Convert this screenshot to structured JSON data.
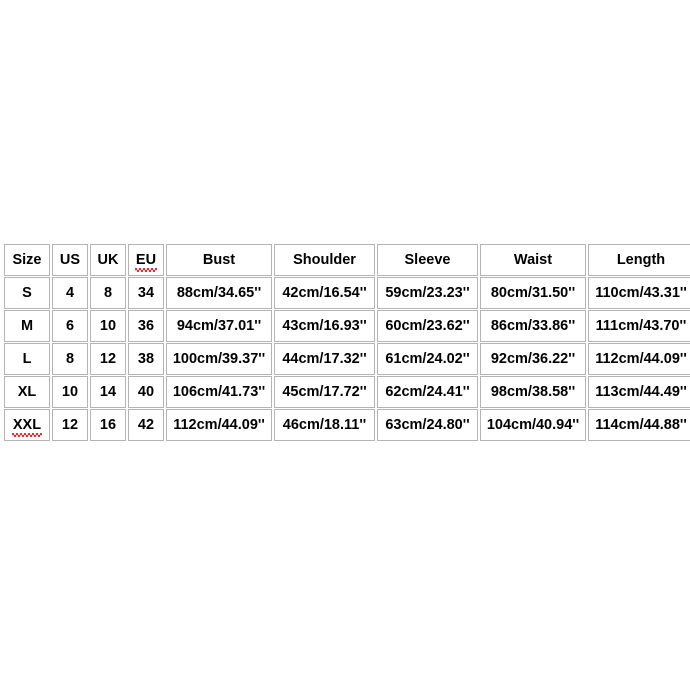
{
  "chart_data": {
    "type": "table",
    "title": "",
    "columns": [
      "Size",
      "US",
      "UK",
      "EU",
      "Bust",
      "Shoulder",
      "Sleeve",
      "Waist",
      "Length"
    ],
    "rows": [
      {
        "size": "S",
        "us": "4",
        "uk": "8",
        "eu": "34",
        "bust": "88cm/34.65''",
        "shoulder": "42cm/16.54''",
        "sleeve": "59cm/23.23''",
        "waist": "80cm/31.50''",
        "length": "110cm/43.31''"
      },
      {
        "size": "M",
        "us": "6",
        "uk": "10",
        "eu": "36",
        "bust": "94cm/37.01''",
        "shoulder": "43cm/16.93''",
        "sleeve": "60cm/23.62''",
        "waist": "86cm/33.86''",
        "length": "111cm/43.70''"
      },
      {
        "size": "L",
        "us": "8",
        "uk": "12",
        "eu": "38",
        "bust": "100cm/39.37''",
        "shoulder": "44cm/17.32''",
        "sleeve": "61cm/24.02''",
        "waist": "92cm/36.22''",
        "length": "112cm/44.09''"
      },
      {
        "size": "XL",
        "us": "10",
        "uk": "14",
        "eu": "40",
        "bust": "106cm/41.73''",
        "shoulder": "45cm/17.72''",
        "sleeve": "62cm/24.41''",
        "waist": "98cm/38.58''",
        "length": "113cm/44.49''"
      },
      {
        "size": "XXL",
        "us": "12",
        "uk": "16",
        "eu": "42",
        "bust": "112cm/44.09''",
        "shoulder": "46cm/18.11''",
        "sleeve": "63cm/24.80''",
        "waist": "104cm/40.94''",
        "length": "114cm/44.88''"
      }
    ],
    "spellcheck_marked": [
      "EU",
      "XXL"
    ],
    "colors": {
      "background": "#ffffff",
      "cell_background": "#ffffff",
      "text": "#000000",
      "border": "#b4b4b4",
      "spellcheck_underline": "#e03030"
    }
  },
  "headers": {
    "size": "Size",
    "us": "US",
    "uk": "UK",
    "eu": "EU",
    "bust": "Bust",
    "shoulder": "Shoulder",
    "sleeve": "Sleeve",
    "waist": "Waist",
    "length": "Length"
  }
}
